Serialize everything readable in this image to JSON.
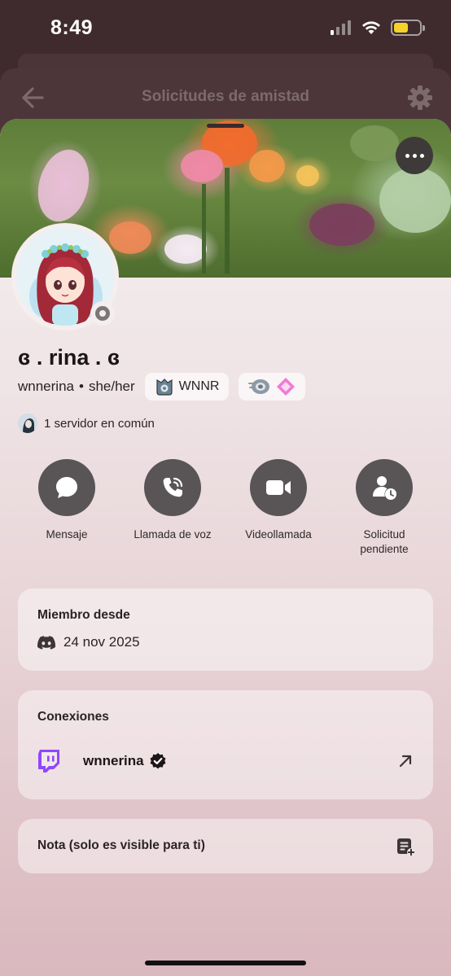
{
  "status_bar": {
    "time": "8:49",
    "battery_color": "#f4d22a"
  },
  "behind": {
    "title": "Solicitudes de amistad",
    "back_icon": "arrow-left-icon",
    "settings_icon": "gear-icon"
  },
  "profile": {
    "display_name": "ɞ . rina . ɞ",
    "username": "wnnerina",
    "separator": "•",
    "pronouns": "she/her",
    "tag_label": "WNNR",
    "mutual_servers": "1 servidor en común",
    "status": "offline"
  },
  "actions": [
    {
      "label": "Mensaje",
      "icon": "message-bubble-icon"
    },
    {
      "label": "Llamada de voz",
      "icon": "phone-icon"
    },
    {
      "label": "Videollamada",
      "icon": "video-camera-icon"
    },
    {
      "label": "Solicitud\npendiente",
      "icon": "pending-request-icon"
    }
  ],
  "member_since": {
    "title": "Miembro desde",
    "date": "24 nov 2025"
  },
  "connections": {
    "title": "Conexiones",
    "items": [
      {
        "service": "Twitch",
        "name": "wnnerina",
        "verified": true
      }
    ]
  },
  "note": {
    "title": "Nota (solo es visible para ti)"
  },
  "colors": {
    "action_bg": "#595556",
    "twitch": "#9146ff"
  }
}
